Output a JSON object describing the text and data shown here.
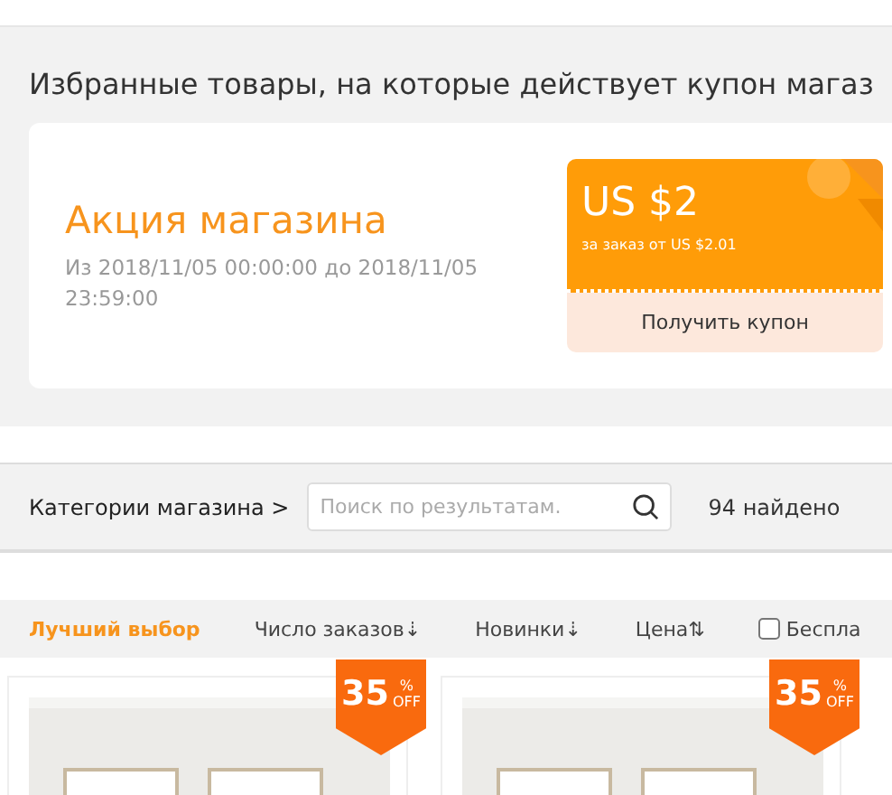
{
  "promo": {
    "heading": "Избранные товары, на которые действует купон магаз",
    "title": "Акция магазина",
    "period": "Из 2018/11/05 00:00:00 до 2018/11/05 23:59:00",
    "coupon": {
      "amount": "US $2",
      "condition": "за заказ от US $2.01",
      "action": "Получить купон"
    }
  },
  "search_bar": {
    "categories": "Категории магазина >",
    "placeholder": "Поиск по результатам.",
    "count": "94 найдено"
  },
  "sort": [
    {
      "label": "Лучший выбор",
      "selected": true
    },
    {
      "label": "Число заказов",
      "arrow": "⇣",
      "selected": false
    },
    {
      "label": "Новинки",
      "arrow": "⇣",
      "selected": false
    },
    {
      "label": "Цена",
      "arrow": "⇅",
      "selected": false
    }
  ],
  "free_shipping": {
    "label": "Беспла",
    "checked": false
  },
  "products": [
    {
      "discount": "35",
      "percent": "%",
      "off": "OFF",
      "kind": "picture"
    },
    {
      "discount": "35",
      "percent": "%",
      "off": "OFF",
      "kind": "picture"
    }
  ]
}
